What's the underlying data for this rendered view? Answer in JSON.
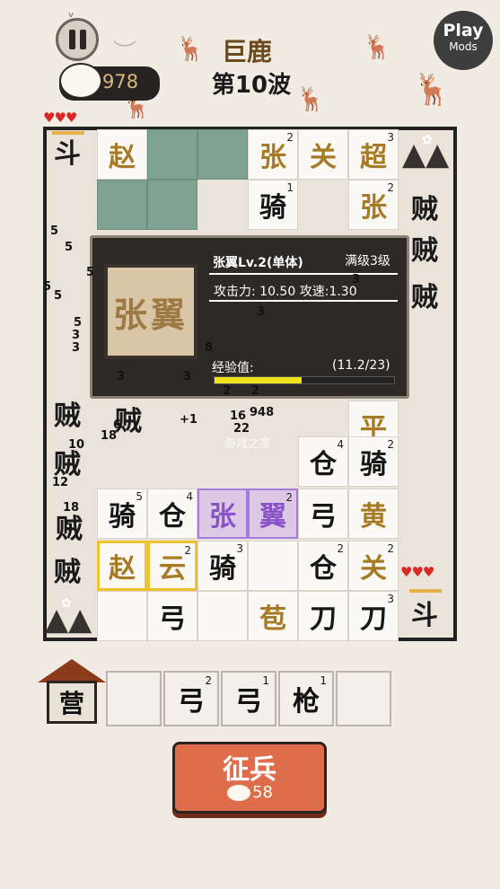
{
  "header": {
    "boss_name": "巨鹿",
    "wave": "第10波",
    "coins": "978",
    "play_mods": {
      "line1": "Play",
      "line2": "Mods"
    }
  },
  "lives": {
    "top": "♥♥♥",
    "bottom": "♥♥♥"
  },
  "side_labels": {
    "left_top": "斗",
    "right_bottom": "斗",
    "right_enemies": [
      "贼",
      "贼",
      "贼"
    ],
    "left_enemies": [
      "贼",
      "贼",
      "贼",
      "贼",
      "贼"
    ]
  },
  "board_tiles": [
    {
      "char": "赵",
      "level": "",
      "style": "gold"
    },
    {
      "char": "张",
      "level": "2",
      "style": "gold"
    },
    {
      "char": "关",
      "level": "",
      "style": "gold"
    },
    {
      "char": "超",
      "level": "3",
      "style": "gold"
    },
    {
      "char": "骑",
      "level": "1",
      "style": "blk"
    },
    {
      "char": "张",
      "level": "2",
      "style": "gold"
    },
    {
      "char": "平",
      "level": "",
      "style": "gold"
    },
    {
      "char": "仓",
      "level": "4",
      "style": "blk"
    },
    {
      "char": "骑",
      "level": "2",
      "style": "blk"
    },
    {
      "char": "骑",
      "level": "5",
      "style": "blk"
    },
    {
      "char": "仓",
      "level": "4",
      "style": "blk"
    },
    {
      "char": "张",
      "level": "",
      "style": "purp"
    },
    {
      "char": "翼",
      "level": "2",
      "style": "purp"
    },
    {
      "char": "弓",
      "level": "",
      "style": "blk"
    },
    {
      "char": "黄",
      "level": "",
      "style": "gold"
    },
    {
      "char": "赵",
      "level": "",
      "style": "gold"
    },
    {
      "char": "云",
      "level": "2",
      "style": "gold"
    },
    {
      "char": "骑",
      "level": "3",
      "style": "blk"
    },
    {
      "char": "仓",
      "level": "2",
      "style": "blk"
    },
    {
      "char": "关",
      "level": "2",
      "style": "gold"
    },
    {
      "char": "弓",
      "level": "",
      "style": "blk"
    },
    {
      "char": "苞",
      "level": "",
      "style": "gold"
    },
    {
      "char": "刀",
      "level": "",
      "style": "blk"
    },
    {
      "char": "刀",
      "level": "3",
      "style": "blk"
    }
  ],
  "popup": {
    "tile_text": "张翼",
    "name": "张翼Lv.2(单体)",
    "max_level": "满级3级",
    "attack_label": "攻击力:",
    "attack_value": "10.50",
    "speed_label": "攻速:",
    "speed_value": "1.30",
    "exp_label": "经验值:",
    "exp_value": "(11.2/23)",
    "exp_fraction": 0.487
  },
  "damage_numbers": [
    "5",
    "5",
    "5",
    "5",
    "5",
    "5",
    "3",
    "3",
    "8",
    "3",
    "18",
    "10",
    "12",
    "18",
    "5",
    "22",
    "948",
    "16",
    "+1",
    "6",
    "3",
    "2",
    "2",
    "3",
    "3"
  ],
  "bench": {
    "barracks_label": "营",
    "slots": [
      {
        "char": "",
        "level": ""
      },
      {
        "char": "弓",
        "level": "2"
      },
      {
        "char": "弓",
        "level": "1"
      },
      {
        "char": "枪",
        "level": "1"
      },
      {
        "char": "",
        "level": ""
      }
    ]
  },
  "recruit": {
    "label": "征兵",
    "cost": "58"
  },
  "watermark": "游戏之家"
}
